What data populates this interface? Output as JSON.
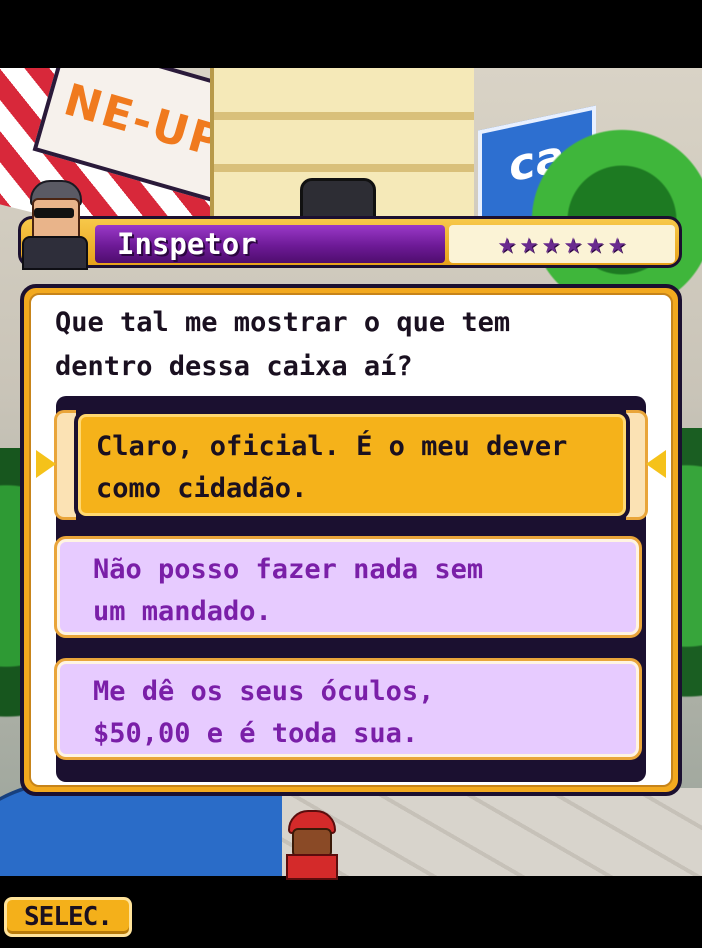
{
  "scene": {
    "shop_sign_text": "NE-UP",
    "blue_sign_text": "ca"
  },
  "speaker": {
    "name": "Inspetor",
    "stars": [
      "★",
      "★",
      "★",
      "★",
      "★",
      "★"
    ]
  },
  "dialog": {
    "question": "Que tal me mostrar o que tem\ndentro dessa caixa aí?",
    "options": [
      {
        "label": "Claro, oficial. É o meu dever\ncomo cidadão.",
        "selected": true
      },
      {
        "label": "Não posso fazer nada sem\num mandado.",
        "selected": false
      },
      {
        "label": "Me dê os seus óculos,\n$50,00 e é toda sua.",
        "selected": false
      }
    ]
  },
  "softkeys": {
    "left_label": "SELEC."
  },
  "colors": {
    "accent_gold": "#f2a91f",
    "name_plate_purple": "#6d1a96",
    "option_text_purple": "#7a1fa8",
    "option_bg_lilac": "#e7cbff"
  }
}
